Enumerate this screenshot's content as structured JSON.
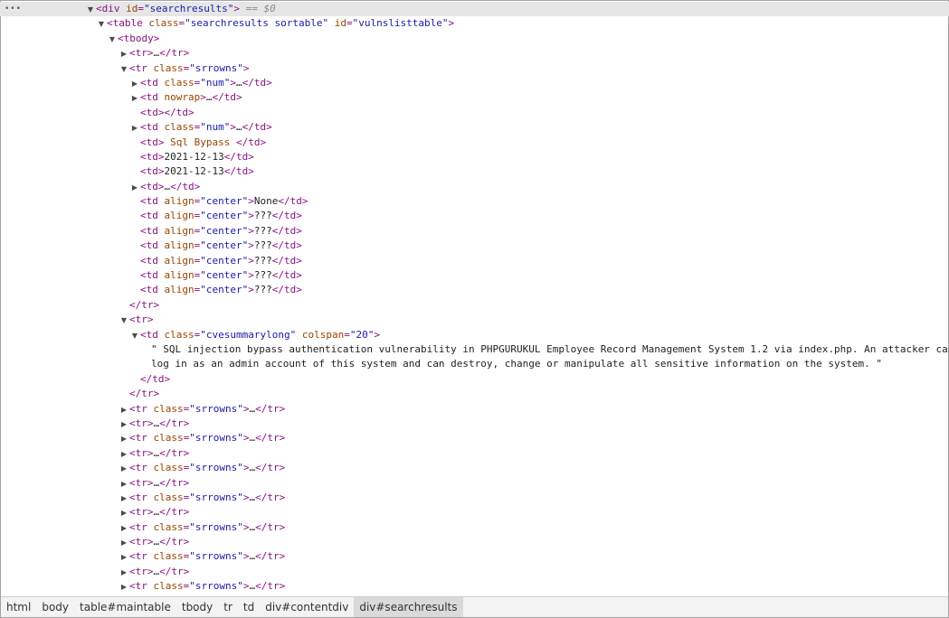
{
  "dom_tree": {
    "root_div": {
      "tag": "div",
      "attr_name": "id",
      "attr_value": "\"searchresults\"",
      "selected_marker": "== $0"
    },
    "table": {
      "tag": "table",
      "class_value": "\"searchresults sortable\"",
      "id_value": "\"vulnslisttable\""
    },
    "tbody": "<tbody>",
    "collapsed_tr": "<tr>…</tr>",
    "expanded_row": {
      "open_tag": "<tr class=\"srrowns\">",
      "cells": [
        "<td class=\"num\">…</td>",
        "<td nowrap>…</td>",
        "<td></td>",
        "<td class=\"num\">…</td>",
        "<td> Sql Bypass </td>",
        "<td>2021-12-13</td>",
        "<td>2021-12-13</td>",
        "<td>…</td>",
        "<td align=\"center\">None</td>",
        "<td align=\"center\">???</td>",
        "<td align=\"center\">???</td>",
        "<td align=\"center\">???</td>",
        "<td align=\"center\">???</td>",
        "<td align=\"center\">???</td>",
        "<td align=\"center\">???</td>"
      ],
      "close_tag": "</tr>"
    },
    "summary_row": {
      "open_tag": "<tr>",
      "td_open": "<td class=\"cvesummarylong\" colspan=\"20\">",
      "text_line_1": "\" SQL injection bypass authentication vulnerability in PHPGURUKUL Employee Record Management System 1.2 via index.php. An attacker can",
      "text_line_2": "log in as an admin account of this system and can destroy, change or manipulate all sensitive information on the system. \"",
      "td_close": "</td>",
      "close_tag": "</tr>"
    },
    "collapsed_rows": [
      "<tr class=\"srrowns\">…</tr>",
      "<tr>…</tr>",
      "<tr class=\"srrowns\">…</tr>",
      "<tr>…</tr>",
      "<tr class=\"srrowns\">…</tr>",
      "<tr>…</tr>",
      "<tr class=\"srrowns\">…</tr>",
      "<tr>…</tr>",
      "<tr class=\"srrowns\">…</tr>",
      "<tr>…</tr>",
      "<tr class=\"srrowns\">…</tr>",
      "<tr>…</tr>",
      "<tr class=\"srrowns\">…</tr>"
    ]
  },
  "breadcrumbs": [
    "html",
    "body",
    "table#maintable",
    "tbody",
    "tr",
    "td",
    "div#contentdiv",
    "div#searchresults"
  ],
  "colors": {
    "tag": "#881280",
    "attr_name": "#994500",
    "attr_value": "#1a1aa6",
    "text": "#222222"
  }
}
